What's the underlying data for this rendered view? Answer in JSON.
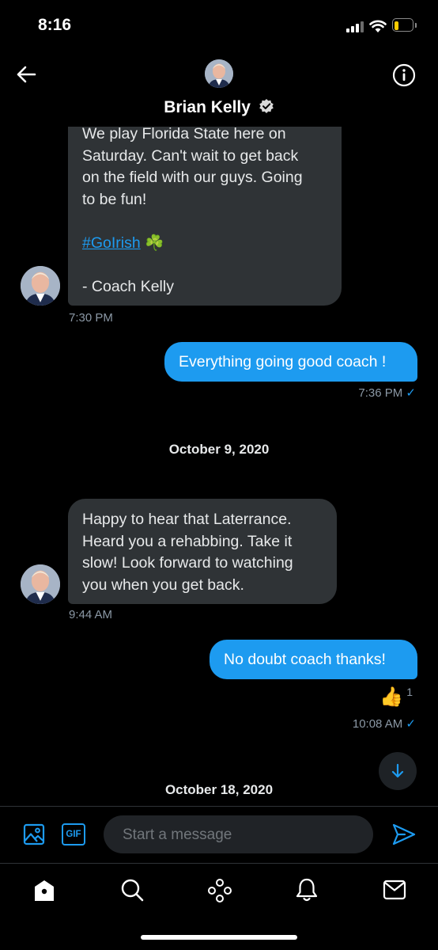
{
  "status_bar": {
    "time": "8:16",
    "battery_level": 0.25
  },
  "header": {
    "back_icon": "arrow-left-icon",
    "contact_name": "Brian Kelly",
    "verified_icon": "verified-badge-icon",
    "info_icon": "info-icon"
  },
  "messages": [
    {
      "direction": "incoming",
      "lines": [
        "We play Florida State here on",
        "Saturday. Can't wait to get back",
        "on the field with our guys. Going",
        "to be fun!"
      ],
      "hashtag": "#GoIrish",
      "emoji": "☘️",
      "signature": "- Coach Kelly",
      "time": "7:30 PM"
    },
    {
      "direction": "outgoing",
      "text": "Everything going good coach !",
      "time": "7:36 PM"
    },
    {
      "type": "date",
      "text": "October 9, 2020"
    },
    {
      "direction": "incoming",
      "lines": [
        "Happy to hear that Laterrance.",
        "Heard you a rehabbing. Take it",
        "slow! Look forward to watching",
        "you when you get back."
      ],
      "time": "9:44 AM"
    },
    {
      "direction": "outgoing",
      "text": "No doubt coach thanks!",
      "reaction": {
        "emoji": "👍",
        "count": "1"
      },
      "time": "10:08 AM"
    },
    {
      "type": "date",
      "text": "October 18, 2020"
    }
  ],
  "read_check": "✓",
  "composer": {
    "placeholder": "Start a message",
    "image_icon": "image-icon",
    "gif_label": "GIF",
    "send_icon": "send-icon"
  },
  "scroll_button_icon": "arrow-down-icon",
  "bottom_nav": [
    "home-icon",
    "search-icon",
    "spaces-icon",
    "notifications-icon",
    "messages-icon"
  ],
  "colors": {
    "accent": "#1d9bf0",
    "incoming_bubble": "#2f3336",
    "background": "#000000"
  }
}
